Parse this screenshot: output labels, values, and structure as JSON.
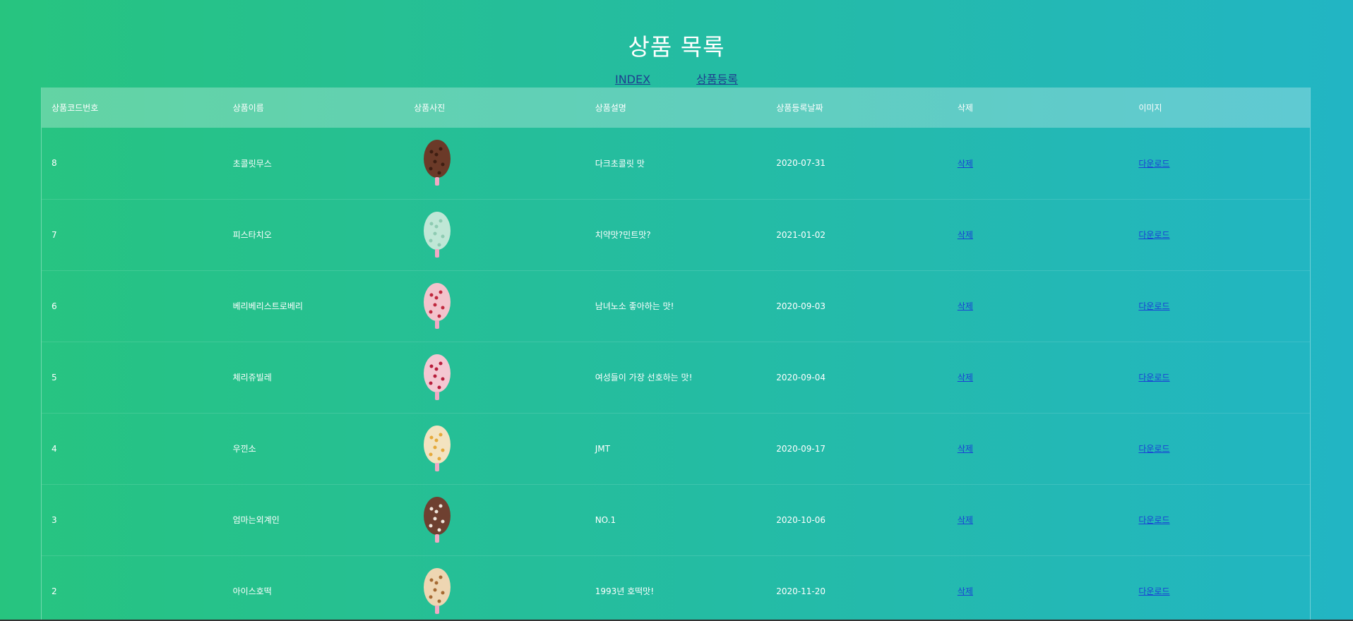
{
  "page": {
    "title": "상품 목록"
  },
  "nav": {
    "index_label": "INDEX",
    "register_label": "상품등록"
  },
  "table": {
    "headers": [
      "상품코드번호",
      "상품이름",
      "상품사진",
      "상품설명",
      "상품등록날짜",
      "삭제",
      "이미지"
    ],
    "rows": [
      {
        "code": "8",
        "name": "초콜릿무스",
        "desc": "다크초콜릿 맛",
        "date": "2020-07-31",
        "delete": "삭제",
        "download": "다운로드",
        "scoop_color": "#6b3a28",
        "speck_color": "#3e1e12"
      },
      {
        "code": "7",
        "name": "피스타치오",
        "desc": "치약맛?민트맛?",
        "date": "2021-01-02",
        "delete": "삭제",
        "download": "다운로드",
        "scoop_color": "#bfe7d6",
        "speck_color": "#8ecbb2"
      },
      {
        "code": "6",
        "name": "베리베리스트로베리",
        "desc": "남녀노소 좋아하는 맛!",
        "date": "2020-09-03",
        "delete": "삭제",
        "download": "다운로드",
        "scoop_color": "#f3c3cc",
        "speck_color": "#c0283e"
      },
      {
        "code": "5",
        "name": "체리쥬빌레",
        "desc": "여성들이 가장 선호하는 맛!",
        "date": "2020-09-04",
        "delete": "삭제",
        "download": "다운로드",
        "scoop_color": "#f4c7d2",
        "speck_color": "#b81d3c"
      },
      {
        "code": "4",
        "name": "우낀소",
        "desc": "JMT",
        "date": "2020-09-17",
        "delete": "삭제",
        "download": "다운로드",
        "scoop_color": "#f3e3c0",
        "speck_color": "#e5a93a"
      },
      {
        "code": "3",
        "name": "엄마는외계인",
        "desc": "NO.1",
        "date": "2020-10-06",
        "delete": "삭제",
        "download": "다운로드",
        "scoop_color": "#6e4030",
        "speck_color": "#f0e6dc"
      },
      {
        "code": "2",
        "name": "아이스호떡",
        "desc": "1993년 호떡맛!",
        "date": "2020-11-20",
        "delete": "삭제",
        "download": "다운로드",
        "scoop_color": "#eed6b2",
        "speck_color": "#a66a32"
      }
    ]
  }
}
